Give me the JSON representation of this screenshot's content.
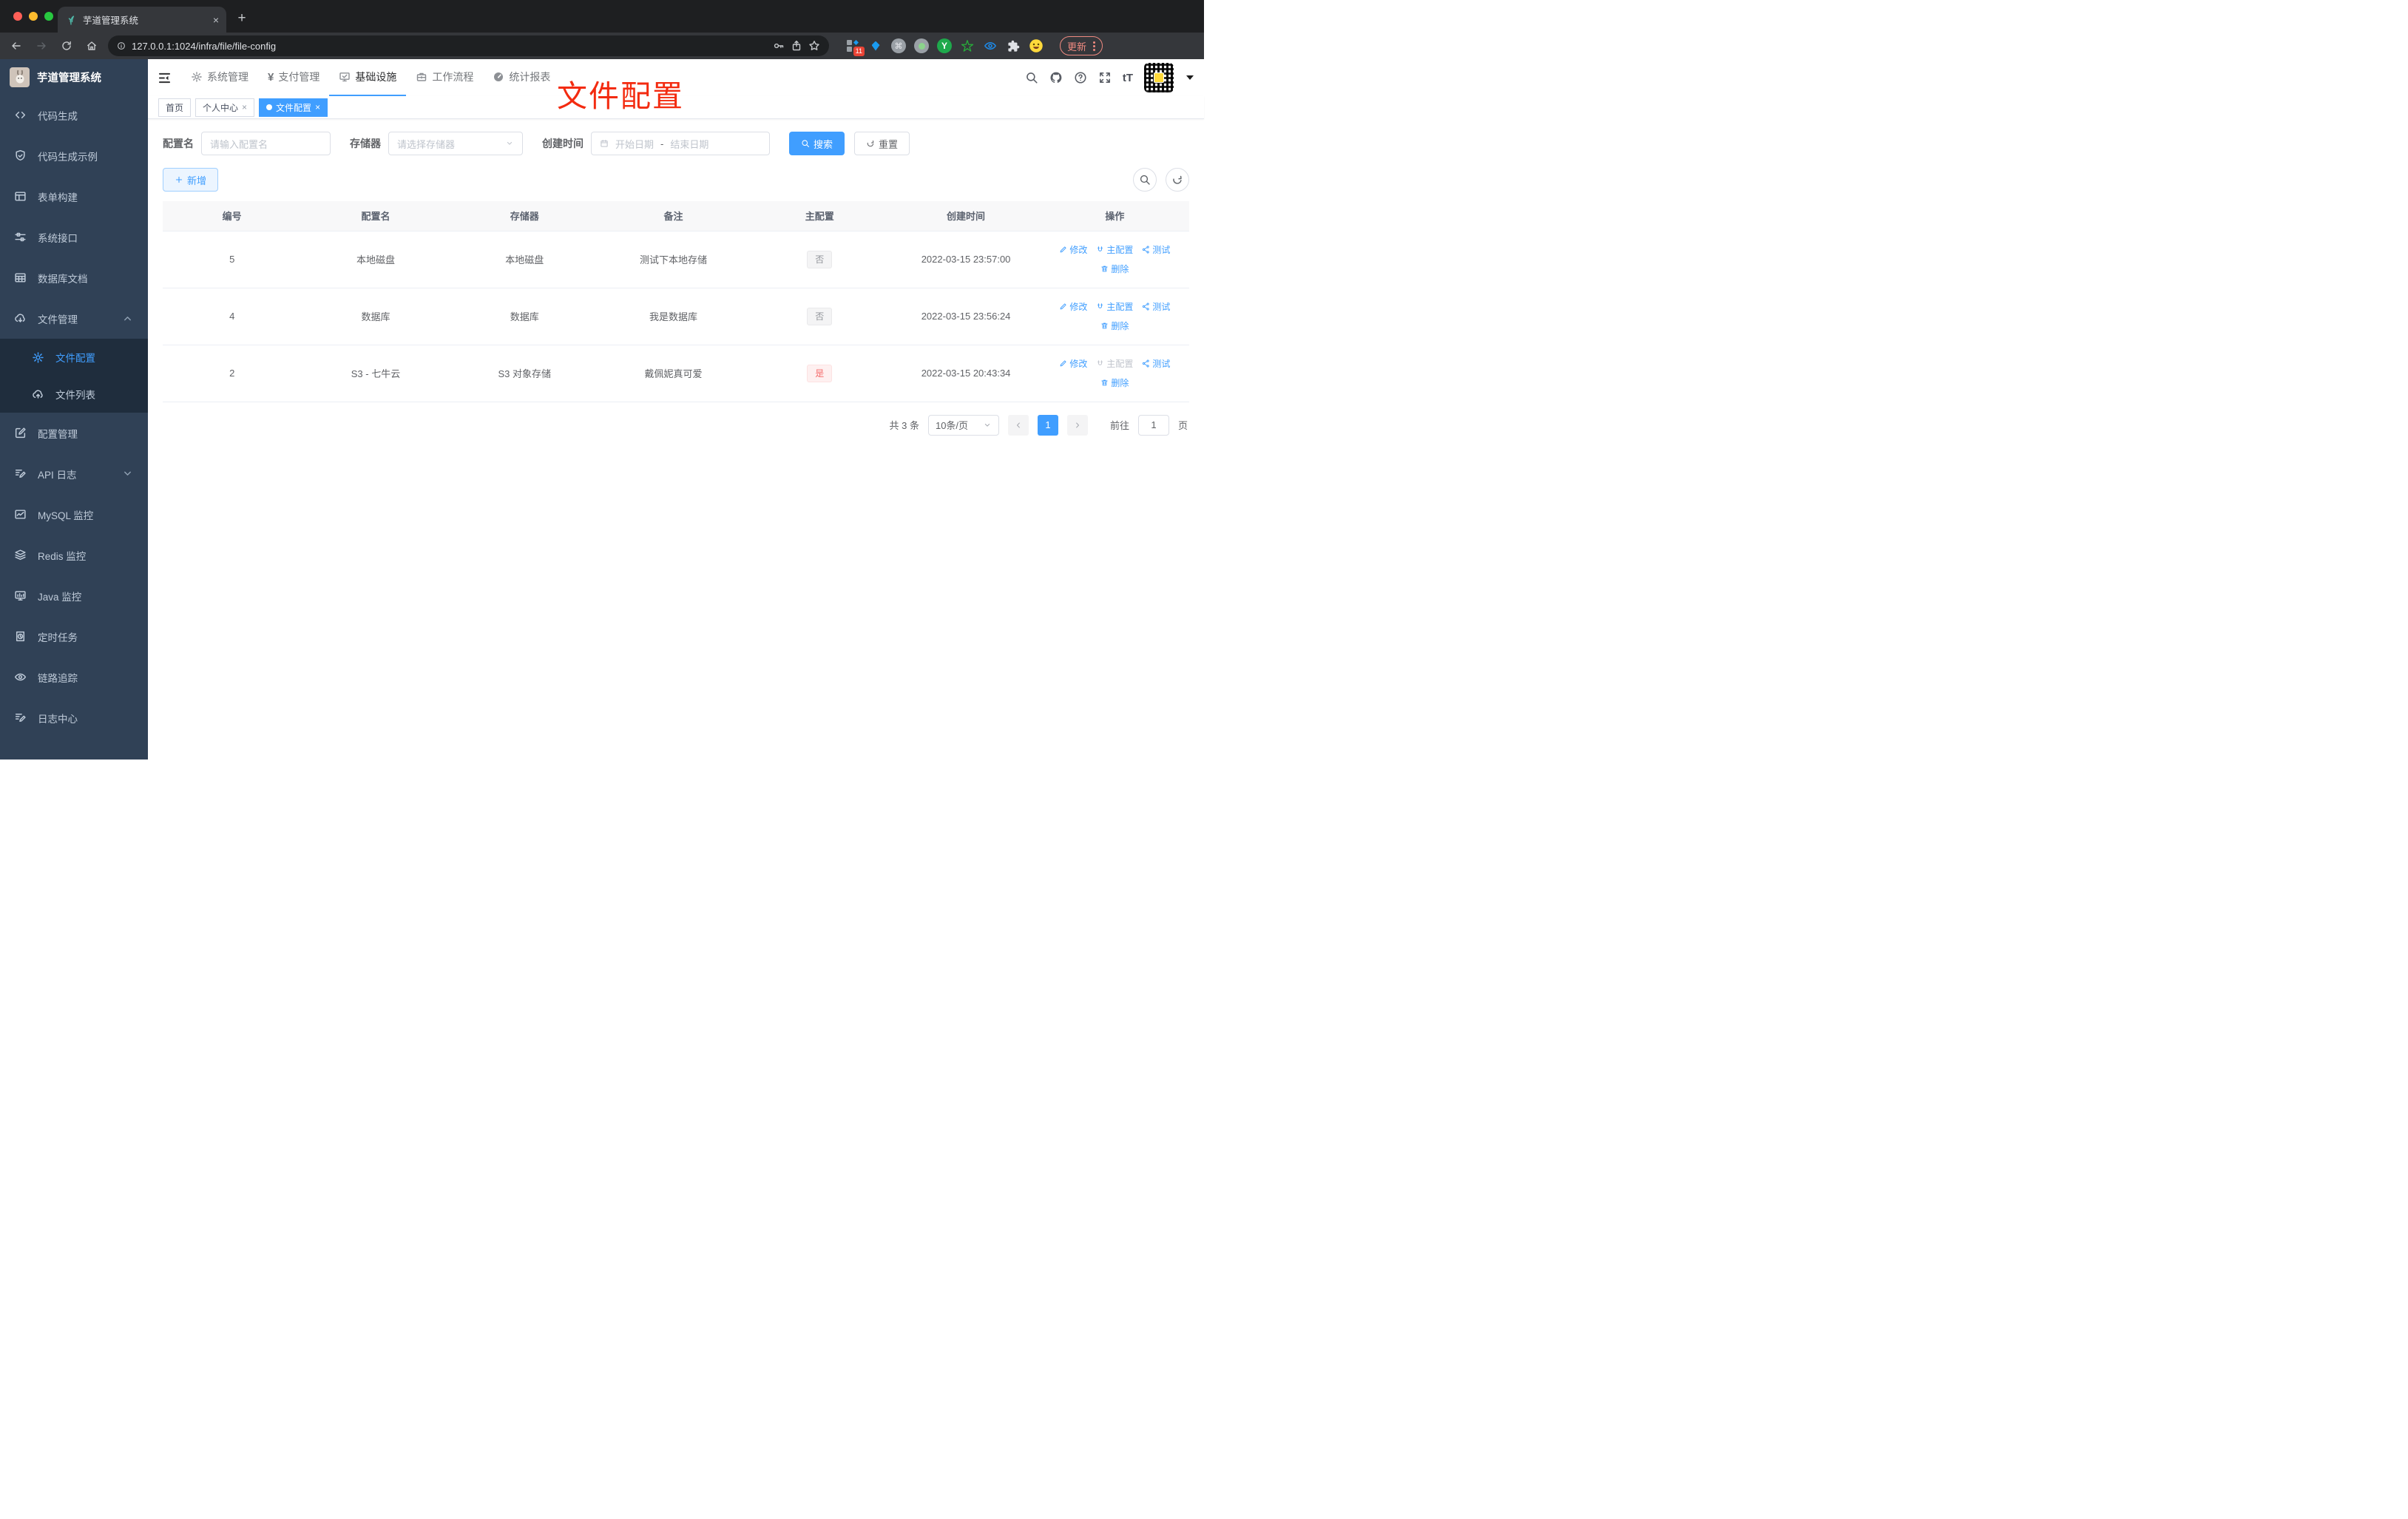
{
  "colors": {
    "accent": "#409eff",
    "danger": "#f56c6c",
    "annotation": "#f32b10",
    "sidebar-bg": "#304156",
    "submenu-bg": "#1f2d3d",
    "sidebar-text": "#bfcbd9"
  },
  "browser": {
    "tab_title": "芋道管理系统",
    "url": "127.0.0.1:1024/infra/file/file-config",
    "ext_badge": "11",
    "update_label": "更新"
  },
  "glyphs": {
    "close": "×",
    "new_tab": "+",
    "yen": "¥",
    "font_size": "tT",
    "cmd": "⌘",
    "y": "Y"
  },
  "sidebar": {
    "title": "芋道管理系统",
    "items": [
      {
        "label": "代码生成"
      },
      {
        "label": "代码生成示例"
      },
      {
        "label": "表单构建"
      },
      {
        "label": "系统接口"
      },
      {
        "label": "数据库文档"
      },
      {
        "label": "文件管理"
      },
      {
        "label": "文件配置"
      },
      {
        "label": "文件列表"
      },
      {
        "label": "配置管理"
      },
      {
        "label": "API 日志"
      },
      {
        "label": "MySQL 监控"
      },
      {
        "label": "Redis 监控"
      },
      {
        "label": "Java 监控"
      },
      {
        "label": "定时任务"
      },
      {
        "label": "链路追踪"
      },
      {
        "label": "日志中心"
      }
    ]
  },
  "nav": {
    "items": [
      {
        "label": "系统管理"
      },
      {
        "label": "支付管理"
      },
      {
        "label": "基础设施"
      },
      {
        "label": "工作流程"
      },
      {
        "label": "统计报表"
      }
    ]
  },
  "tags": {
    "items": [
      {
        "label": "首页"
      },
      {
        "label": "个人中心"
      },
      {
        "label": "文件配置"
      }
    ]
  },
  "annotation": {
    "text": "文件配置"
  },
  "filters": {
    "name_label": "配置名",
    "name_placeholder": "请输入配置名",
    "storage_label": "存储器",
    "storage_placeholder": "请选择存储器",
    "time_label": "创建时间",
    "start_placeholder": "开始日期",
    "separator": "-",
    "end_placeholder": "结束日期",
    "search_label": "搜索",
    "reset_label": "重置"
  },
  "toolbar": {
    "add_label": "新增"
  },
  "table": {
    "columns": [
      "编号",
      "配置名",
      "存储器",
      "备注",
      "主配置",
      "创建时间",
      "操作"
    ],
    "action_labels": {
      "edit": "修改",
      "master": "主配置",
      "test": "测试",
      "delete": "删除"
    },
    "rows": [
      {
        "id": "5",
        "name": "本地磁盘",
        "storage": "本地磁盘",
        "remark": "测试下本地存储",
        "master": "否",
        "created": "2022-03-15 23:57:00"
      },
      {
        "id": "4",
        "name": "数据库",
        "storage": "数据库",
        "remark": "我是数据库",
        "master": "否",
        "created": "2022-03-15 23:56:24"
      },
      {
        "id": "2",
        "name": "S3 - 七牛云",
        "storage": "S3 对象存储",
        "remark": "戴佩妮真可爱",
        "master": "是",
        "created": "2022-03-15 20:43:34"
      }
    ]
  },
  "pagination": {
    "total": "共 3 条",
    "page_size": "10条/页",
    "page": "1",
    "goto_label": "前往",
    "goto_value": "1",
    "page_label": "页"
  }
}
